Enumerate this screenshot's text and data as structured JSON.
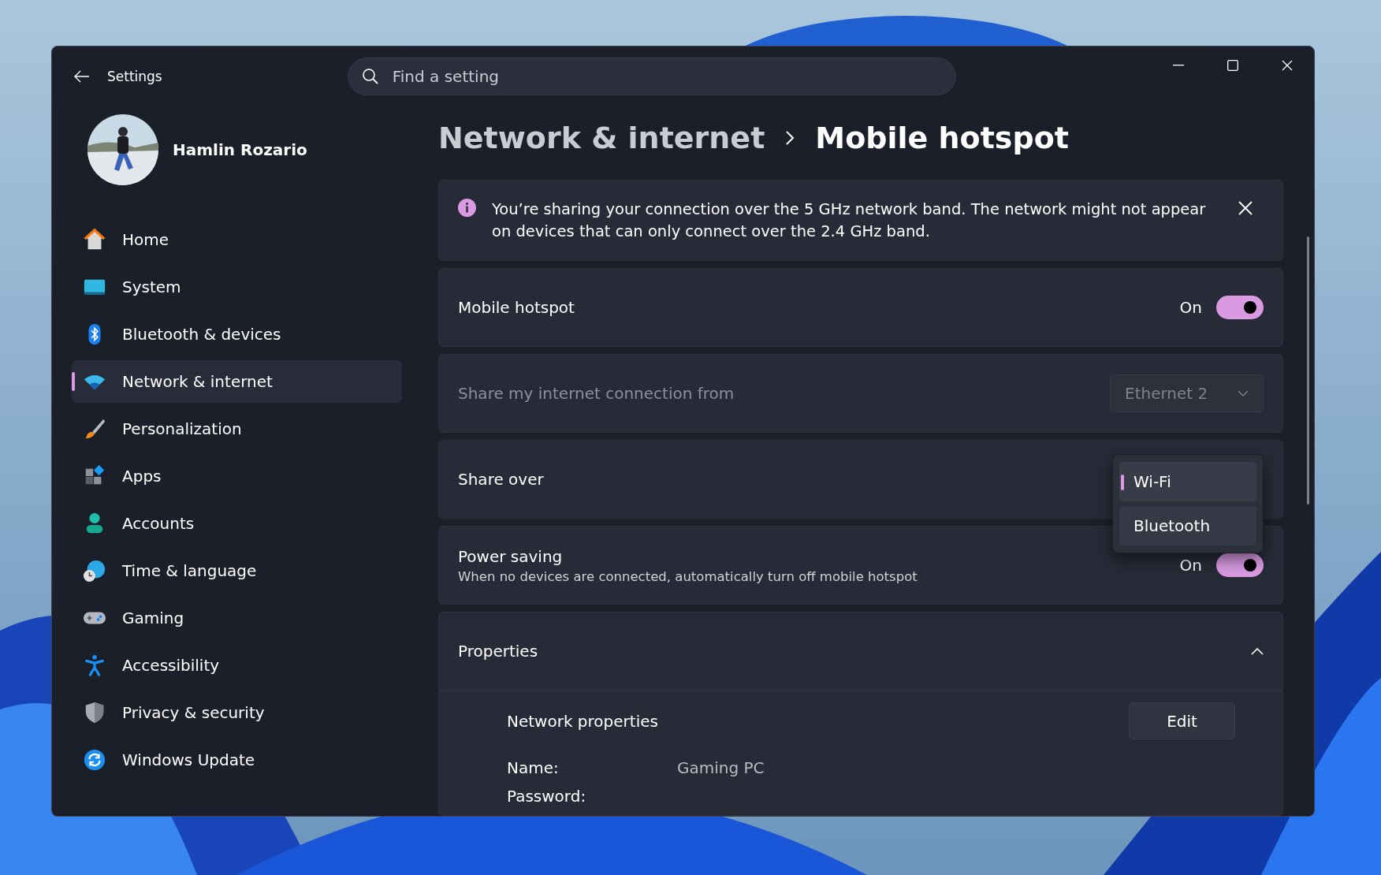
{
  "window": {
    "title": "Settings"
  },
  "search": {
    "placeholder": "Find a setting"
  },
  "user": {
    "name": "Hamlin Rozario"
  },
  "sidebar": {
    "items": [
      {
        "label": "Home",
        "selected": false
      },
      {
        "label": "System",
        "selected": false
      },
      {
        "label": "Bluetooth & devices",
        "selected": false
      },
      {
        "label": "Network & internet",
        "selected": true
      },
      {
        "label": "Personalization",
        "selected": false
      },
      {
        "label": "Apps",
        "selected": false
      },
      {
        "label": "Accounts",
        "selected": false
      },
      {
        "label": "Time & language",
        "selected": false
      },
      {
        "label": "Gaming",
        "selected": false
      },
      {
        "label": "Accessibility",
        "selected": false
      },
      {
        "label": "Privacy & security",
        "selected": false
      },
      {
        "label": "Windows Update",
        "selected": false
      }
    ]
  },
  "breadcrumb": [
    "Network & internet",
    "Mobile hotspot"
  ],
  "notice": {
    "text": "You’re sharing your connection over the 5 GHz network band. The network might not appear on devices that can only connect over the 2.4 GHz band."
  },
  "settings": [
    {
      "kind": "toggle",
      "label": "Mobile hotspot",
      "state_text": "On",
      "on": true
    },
    {
      "kind": "dropdown",
      "label": "Share my internet connection from",
      "value": "Ethernet 2",
      "disabled": true
    },
    {
      "kind": "choice",
      "label": "Share over",
      "options": [
        {
          "label": "Wi-Fi",
          "selected": true
        },
        {
          "label": "Bluetooth",
          "selected": false
        }
      ]
    },
    {
      "kind": "toggle",
      "label": "Power saving",
      "description": "When no devices are connected, automatically turn off mobile hotspot",
      "state_text": "On",
      "on": true
    },
    {
      "kind": "expander",
      "label": "Properties",
      "expanded": true
    }
  ],
  "properties": {
    "title": "Network properties",
    "button": "Edit",
    "fields": [
      {
        "label": "Name:",
        "value": "Gaming PC"
      },
      {
        "label": "Password:"
      }
    ]
  }
}
